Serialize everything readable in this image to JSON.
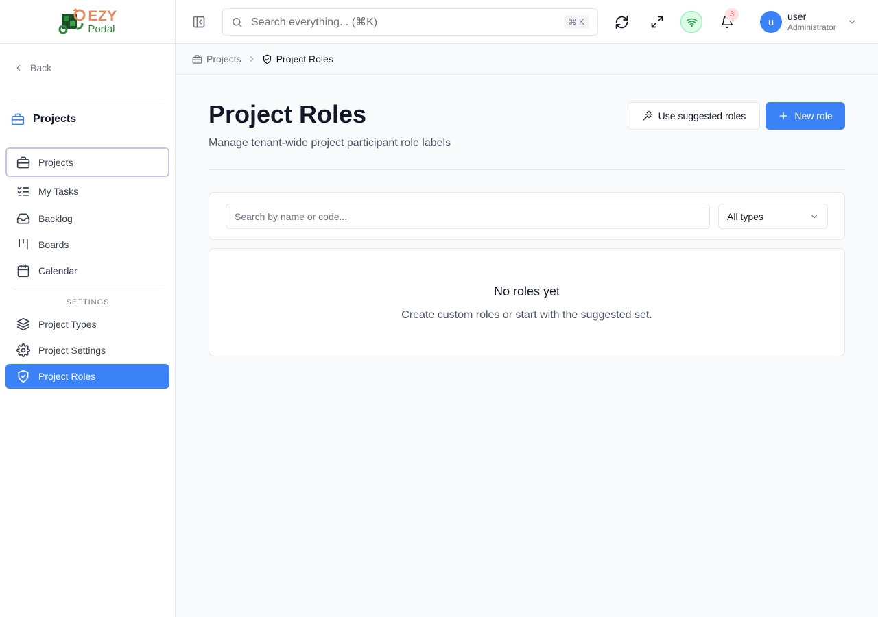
{
  "brand": {
    "logo_top": "EZY",
    "logo_bottom": "Portal"
  },
  "sidebar": {
    "back_label": "Back",
    "section_title": "Projects",
    "items": [
      {
        "label": "Projects",
        "icon": "briefcase-icon"
      },
      {
        "label": "My Tasks",
        "icon": "list-checks-icon"
      },
      {
        "label": "Backlog",
        "icon": "inbox-icon"
      },
      {
        "label": "Boards",
        "icon": "kanban-icon"
      },
      {
        "label": "Calendar",
        "icon": "calendar-icon"
      }
    ],
    "settings_label": "SETTINGS",
    "settings_items": [
      {
        "label": "Project Types",
        "icon": "layers-icon"
      },
      {
        "label": "Project Settings",
        "icon": "gear-icon"
      },
      {
        "label": "Project Roles",
        "icon": "shield-check-icon",
        "active": true
      }
    ]
  },
  "header": {
    "search_placeholder": "Search everything... (⌘K)",
    "search_shortcut": "⌘ K",
    "notification_count": "3",
    "user_name": "user",
    "user_role": "Administrator",
    "avatar_letter": "u"
  },
  "breadcrumb": {
    "parent": "Projects",
    "current": "Project Roles"
  },
  "main": {
    "title": "Project Roles",
    "subtitle": "Manage tenant-wide project participant role labels",
    "suggested_button": "Use suggested roles",
    "new_button": "New role",
    "filter_placeholder": "Search by name or code...",
    "type_select": "All types",
    "empty_title": "No roles yet",
    "empty_description": "Create custom roles or start with the suggested set."
  },
  "colors": {
    "accent": "#3b82f6",
    "logo_orange": "#e8875a",
    "logo_green": "#2f8a3a",
    "status_online": "#22c55e"
  }
}
